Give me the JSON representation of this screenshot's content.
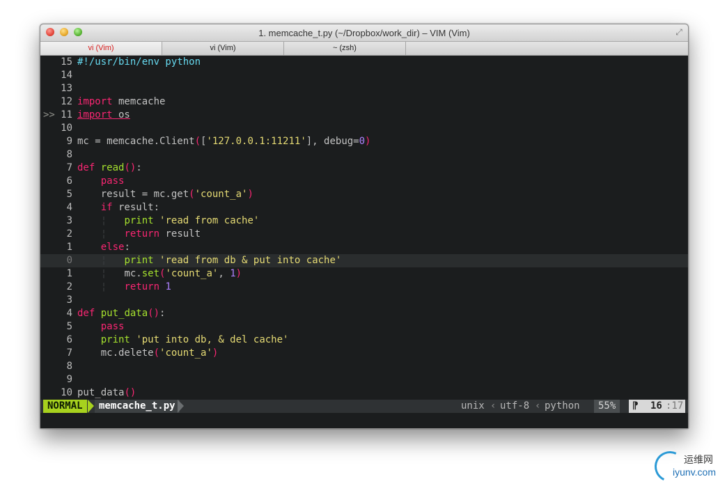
{
  "window": {
    "title": "1. memcache_t.py (~/Dropbox/work_dir) – VIM (Vim)"
  },
  "tabs": [
    {
      "label": "vi (Vim)",
      "active": true
    },
    {
      "label": "vi (Vim)",
      "active": false
    },
    {
      "label": "~ (zsh)",
      "active": false
    }
  ],
  "editor": {
    "lines": [
      {
        "num": "15",
        "sign": "",
        "tokens": [
          [
            "shebang",
            "#!/usr/bin/env python"
          ]
        ]
      },
      {
        "num": "14",
        "sign": "",
        "tokens": []
      },
      {
        "num": "13",
        "sign": "",
        "tokens": []
      },
      {
        "num": "12",
        "sign": "",
        "tokens": [
          [
            "kw",
            "import"
          ],
          [
            "plain",
            " memcache"
          ]
        ]
      },
      {
        "num": "11",
        "sign": ">>",
        "tokens": [
          [
            "kw err",
            "import"
          ],
          [
            "plain err",
            " os"
          ]
        ]
      },
      {
        "num": "10",
        "sign": "",
        "tokens": []
      },
      {
        "num": "9",
        "sign": "",
        "tokens": [
          [
            "plain",
            "mc = memcache.Client"
          ],
          [
            "paren",
            "("
          ],
          [
            "plain",
            "["
          ],
          [
            "str",
            "'127.0.0.1:11211'"
          ],
          [
            "plain",
            "], debug="
          ],
          [
            "num-lit",
            "0"
          ],
          [
            "paren",
            ")"
          ]
        ]
      },
      {
        "num": "8",
        "sign": "",
        "tokens": []
      },
      {
        "num": "7",
        "sign": "",
        "tokens": [
          [
            "kw",
            "def"
          ],
          [
            "plain",
            " "
          ],
          [
            "fn",
            "read"
          ],
          [
            "paren",
            "()"
          ],
          [
            "plain",
            ":"
          ]
        ]
      },
      {
        "num": "6",
        "sign": "",
        "tokens": [
          [
            "plain",
            "    "
          ],
          [
            "kw",
            "pass"
          ]
        ]
      },
      {
        "num": "5",
        "sign": "",
        "tokens": [
          [
            "plain",
            "    result = mc.get"
          ],
          [
            "paren",
            "("
          ],
          [
            "str",
            "'count_a'"
          ],
          [
            "paren",
            ")"
          ]
        ]
      },
      {
        "num": "4",
        "sign": "",
        "tokens": [
          [
            "plain",
            "    "
          ],
          [
            "kw",
            "if"
          ],
          [
            "plain",
            " result:"
          ]
        ]
      },
      {
        "num": "3",
        "sign": "",
        "tokens": [
          [
            "plain",
            "    "
          ],
          [
            "indent-guide",
            "¦"
          ],
          [
            "plain",
            "   "
          ],
          [
            "pr",
            "print"
          ],
          [
            "plain",
            " "
          ],
          [
            "str",
            "'read from cache'"
          ]
        ]
      },
      {
        "num": "2",
        "sign": "",
        "tokens": [
          [
            "plain",
            "    "
          ],
          [
            "indent-guide",
            "¦"
          ],
          [
            "plain",
            "   "
          ],
          [
            "kw",
            "return"
          ],
          [
            "plain",
            " result"
          ]
        ]
      },
      {
        "num": "1",
        "sign": "",
        "tokens": [
          [
            "plain",
            "    "
          ],
          [
            "kw",
            "else"
          ],
          [
            "plain",
            ":"
          ]
        ]
      },
      {
        "num": "0",
        "sign": "",
        "current": true,
        "tokens": [
          [
            "plain",
            "    "
          ],
          [
            "indent-guide",
            "¦"
          ],
          [
            "plain",
            "   "
          ],
          [
            "pr",
            "print"
          ],
          [
            "plain",
            " "
          ],
          [
            "str",
            "'read from db & put into cache'"
          ]
        ]
      },
      {
        "num": "1",
        "sign": "",
        "tokens": [
          [
            "plain",
            "    "
          ],
          [
            "indent-guide",
            "¦"
          ],
          [
            "plain",
            "   mc."
          ],
          [
            "fn",
            "set"
          ],
          [
            "paren",
            "("
          ],
          [
            "str",
            "'count_a'"
          ],
          [
            "plain",
            ", "
          ],
          [
            "num-lit",
            "1"
          ],
          [
            "paren",
            ")"
          ]
        ]
      },
      {
        "num": "2",
        "sign": "",
        "tokens": [
          [
            "plain",
            "    "
          ],
          [
            "indent-guide",
            "¦"
          ],
          [
            "plain",
            "   "
          ],
          [
            "kw",
            "return"
          ],
          [
            "plain",
            " "
          ],
          [
            "num-lit",
            "1"
          ]
        ]
      },
      {
        "num": "3",
        "sign": "",
        "tokens": []
      },
      {
        "num": "4",
        "sign": "",
        "tokens": [
          [
            "kw",
            "def"
          ],
          [
            "plain",
            " "
          ],
          [
            "fn",
            "put_data"
          ],
          [
            "paren",
            "()"
          ],
          [
            "plain",
            ":"
          ]
        ]
      },
      {
        "num": "5",
        "sign": "",
        "tokens": [
          [
            "plain",
            "    "
          ],
          [
            "kw",
            "pass"
          ]
        ]
      },
      {
        "num": "6",
        "sign": "",
        "tokens": [
          [
            "plain",
            "    "
          ],
          [
            "pr",
            "print"
          ],
          [
            "plain",
            " "
          ],
          [
            "str",
            "'put into db, & del cache'"
          ]
        ]
      },
      {
        "num": "7",
        "sign": "",
        "tokens": [
          [
            "plain",
            "    mc.delete"
          ],
          [
            "paren",
            "("
          ],
          [
            "str",
            "'count_a'"
          ],
          [
            "paren",
            ")"
          ]
        ]
      },
      {
        "num": "8",
        "sign": "",
        "tokens": []
      },
      {
        "num": "9",
        "sign": "",
        "tokens": []
      },
      {
        "num": "10",
        "sign": "",
        "tokens": [
          [
            "plain",
            "put_data"
          ],
          [
            "paren",
            "()"
          ]
        ]
      }
    ]
  },
  "statusbar": {
    "mode": "NORMAL",
    "filename": "memcache_t.py",
    "fileformat": "unix",
    "encoding": "utf-8",
    "filetype": "python",
    "percent": "55%",
    "line": "16",
    "col": "17",
    "separator": "‹"
  },
  "watermark": {
    "cn": "运维网",
    "en": "iyunv.com"
  },
  "colors": {
    "keyword": "#f92672",
    "function": "#a6e22e",
    "string": "#e6db74",
    "number": "#ae81ff",
    "mode_bg": "#a7d11e",
    "background": "#1b1d1e"
  }
}
